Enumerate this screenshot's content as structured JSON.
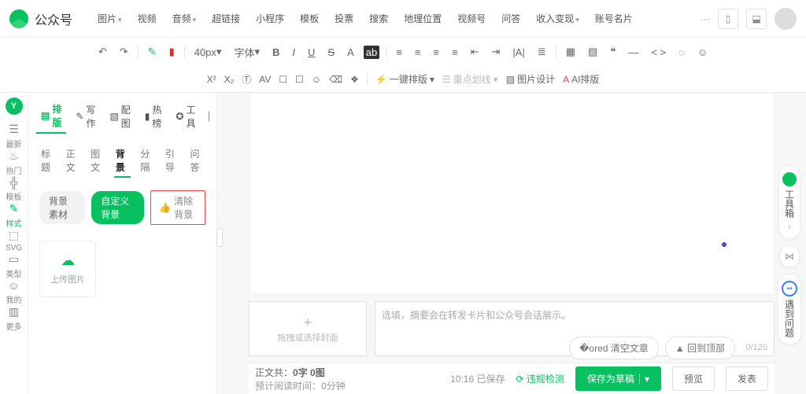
{
  "header": {
    "title": "公众号",
    "menu": [
      "图片",
      "视频",
      "音频",
      "超链接",
      "小程序",
      "模板",
      "投票",
      "搜索",
      "地理位置",
      "视频号",
      "问答",
      "收入变现",
      "账号名片"
    ],
    "menu_caret": [
      true,
      false,
      true,
      false,
      false,
      false,
      false,
      false,
      false,
      false,
      false,
      true,
      false
    ],
    "more": "···"
  },
  "toolbar1": {
    "undo": "↶",
    "redo": "↷",
    "brush": "✎",
    "paint": "▮",
    "size": "40px",
    "font": "字体",
    "bold": "B",
    "italic": "I",
    "underline": "U",
    "strike": "S",
    "fontcolor": "A",
    "bgcolor": "ab",
    "alignL": "≡",
    "alignC": "≡",
    "alignR": "≡",
    "alignJ": "≡",
    "indentL": "⇤",
    "indentR": "⇥",
    "lineH": "|A|",
    "list": "≣",
    "table": "▦",
    "image": "▧",
    "quote": "❝",
    "code": "< >",
    "ellipsis": "◌",
    "emoji": "☺"
  },
  "toolbar2": {
    "sup": "X²",
    "sub": "X₂",
    "t1": "Ⓣ",
    "t2": "AV",
    "t3": "☐",
    "t4": "☐",
    "t5": "☺",
    "t6": "⌫",
    "t7": "❖",
    "onekey": "一键排版",
    "keyline": "重点划线",
    "imgdesign": "图片设计",
    "ai": "AI排版"
  },
  "rail": {
    "items": [
      {
        "icon": "☰",
        "label": "最新"
      },
      {
        "icon": "♨",
        "label": "热门"
      },
      {
        "icon": "╬",
        "label": "模板"
      },
      {
        "icon": "✎",
        "label": "样式"
      },
      {
        "icon": "⬚",
        "label": "SVG"
      },
      {
        "icon": "▭",
        "label": "类型"
      },
      {
        "icon": "☺",
        "label": "我的"
      },
      {
        "icon": "▥",
        "label": "更多"
      }
    ],
    "active_index": 3
  },
  "panel": {
    "tabs": [
      {
        "icon": "▤",
        "label": "排版"
      },
      {
        "icon": "✎",
        "label": "写作"
      },
      {
        "icon": "▧",
        "label": "配图"
      },
      {
        "icon": "▮",
        "label": "热榜"
      },
      {
        "icon": "✪",
        "label": "工具"
      }
    ],
    "active_tab": 0,
    "subtabs": [
      "标题",
      "正文",
      "图文",
      "背景",
      "分隔",
      "引导",
      "问答"
    ],
    "active_subtab": 3,
    "bg_chips": [
      "背景素材",
      "自定义背景"
    ],
    "active_chip": 1,
    "clear_label": "清除背景",
    "upload_label": "上传图片"
  },
  "summary": {
    "cover_plus": "+",
    "cover_hint": "拖拽或选择封面",
    "placeholder": "选填，摘要会在转发卡片和公众号会话展示。",
    "count": "0/120"
  },
  "footer": {
    "words_label": "正文共：",
    "words_value": "0字 0图",
    "readtime_label": "预计阅读时间：",
    "readtime_value": "0分钟",
    "saved_time": "10:16",
    "saved_label": "已保存",
    "violation": "违规检测",
    "save_draft": "保存为草稿",
    "preview": "预览",
    "publish": "发表"
  },
  "float": {
    "toolbox": "工具箱",
    "issue": "遇到问题",
    "clear_article": "清空文章",
    "back_top": "回到顶部"
  }
}
